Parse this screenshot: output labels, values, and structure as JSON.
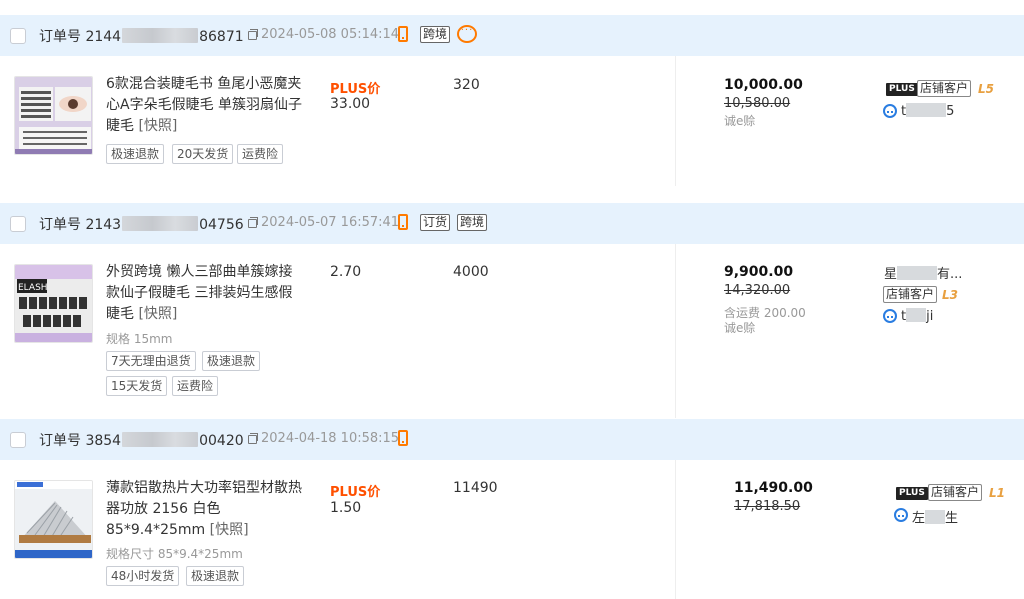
{
  "orders": [
    {
      "order_prefix": "订单号 2144",
      "order_suffix": "86871",
      "time": "2024-05-08 05:14:14",
      "tags": [
        "跨境"
      ],
      "product": {
        "title": "6款混合装睫毛书 鱼尾小恶魔夹心A字朵毛假睫毛 单簇羽扇仙子睫毛",
        "snapshot": "[快照]",
        "spec": "",
        "services": [
          "极速退款",
          "20天发货",
          "运费险"
        ]
      },
      "price_label": "PLUS价",
      "unit_price": "33.00",
      "quantity": "320",
      "total": "10,000.00",
      "original": "10,580.00",
      "shipping_note": "",
      "payment_note": "诚e赊",
      "buyer": {
        "plus": "PLUS",
        "customer_tag": "店铺客户",
        "level": "L5",
        "name_start": "t",
        "name_end": "5"
      }
    },
    {
      "order_prefix": "订单号 2143",
      "order_suffix": "04756",
      "time": "2024-05-07 16:57:41",
      "tags": [
        "订货",
        "跨境"
      ],
      "product": {
        "title": "外贸跨境 懒人三部曲单簇嫁接款仙子假睫毛 三排装妈生感假睫毛",
        "snapshot": "[快照]",
        "spec": "规格 15mm",
        "services": [
          "7天无理由退货",
          "极速退款",
          "15天发货",
          "运费险"
        ]
      },
      "price_label": "",
      "unit_price": "2.70",
      "quantity": "4000",
      "total": "9,900.00",
      "original": "14,320.00",
      "shipping_note": "含运费 200.00",
      "payment_note": "诚e赊",
      "buyer": {
        "company_start": "星",
        "company_end": "有...",
        "customer_tag": "店铺客户",
        "level": "L3",
        "name_start": "t",
        "name_end": "ji"
      }
    },
    {
      "order_prefix": "订单号 3854",
      "order_suffix": "00420",
      "time": "2024-04-18 10:58:15",
      "tags": [],
      "product": {
        "title": "薄款铝散热片大功率铝型材散热器功放 2156 白色 85*9.4*25mm",
        "snapshot": "[快照]",
        "spec": "规格尺寸 85*9.4*25mm",
        "services": [
          "48小时发货",
          "极速退款"
        ]
      },
      "price_label": "PLUS价",
      "unit_price": "1.50",
      "quantity": "11490",
      "total": "11,490.00",
      "original": "17,818.50",
      "shipping_note": "",
      "payment_note": "",
      "buyer": {
        "plus": "PLUS",
        "customer_tag": "店铺客户",
        "level": "L1",
        "name_start": "左",
        "name_end": "生"
      }
    }
  ],
  "icons": {
    "copy": "copy-icon",
    "phone": "phone-icon",
    "chat": "chat-icon",
    "wangwang": "wangwang-icon"
  },
  "colors": {
    "header_bg": "#e6f2fd",
    "plus_price": "#ff5000",
    "level": "#e8a040",
    "phone": "#ff7a00",
    "chat": "#2a7de1"
  }
}
